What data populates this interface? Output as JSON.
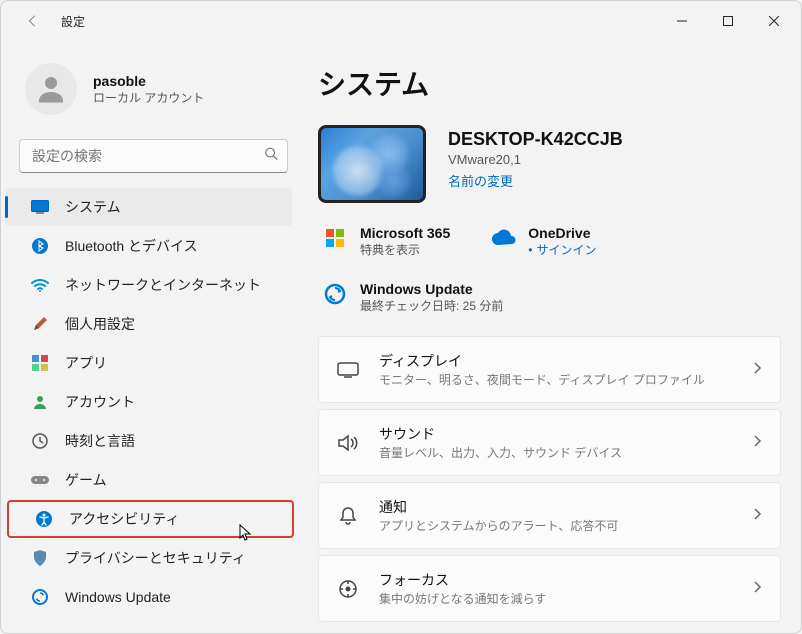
{
  "titlebar": {
    "title": "設定"
  },
  "user": {
    "name": "pasoble",
    "subtitle": "ローカル アカウント"
  },
  "search": {
    "placeholder": "設定の検索"
  },
  "nav": {
    "items": [
      {
        "label": "システム"
      },
      {
        "label": "Bluetooth とデバイス"
      },
      {
        "label": "ネットワークとインターネット"
      },
      {
        "label": "個人用設定"
      },
      {
        "label": "アプリ"
      },
      {
        "label": "アカウント"
      },
      {
        "label": "時刻と言語"
      },
      {
        "label": "ゲーム"
      },
      {
        "label": "アクセシビリティ"
      },
      {
        "label": "プライバシーとセキュリティ"
      },
      {
        "label": "Windows Update"
      }
    ]
  },
  "main": {
    "title": "システム",
    "device": {
      "name": "DESKTOP-K42CCJB",
      "model": "VMware20,1",
      "rename": "名前の変更"
    },
    "services": {
      "m365": {
        "title": "Microsoft 365",
        "sub": "特典を表示"
      },
      "onedrive": {
        "title": "OneDrive",
        "link": "サインイン"
      },
      "winupdate": {
        "title": "Windows Update",
        "sub": "最終チェック日時: 25 分前"
      }
    },
    "cards": [
      {
        "title": "ディスプレイ",
        "sub": "モニター、明るさ、夜間モード、ディスプレイ プロファイル"
      },
      {
        "title": "サウンド",
        "sub": "音量レベル、出力、入力、サウンド デバイス"
      },
      {
        "title": "通知",
        "sub": "アプリとシステムからのアラート、応答不可"
      },
      {
        "title": "フォーカス",
        "sub": "集中の妨げとなる通知を減らす"
      }
    ]
  }
}
